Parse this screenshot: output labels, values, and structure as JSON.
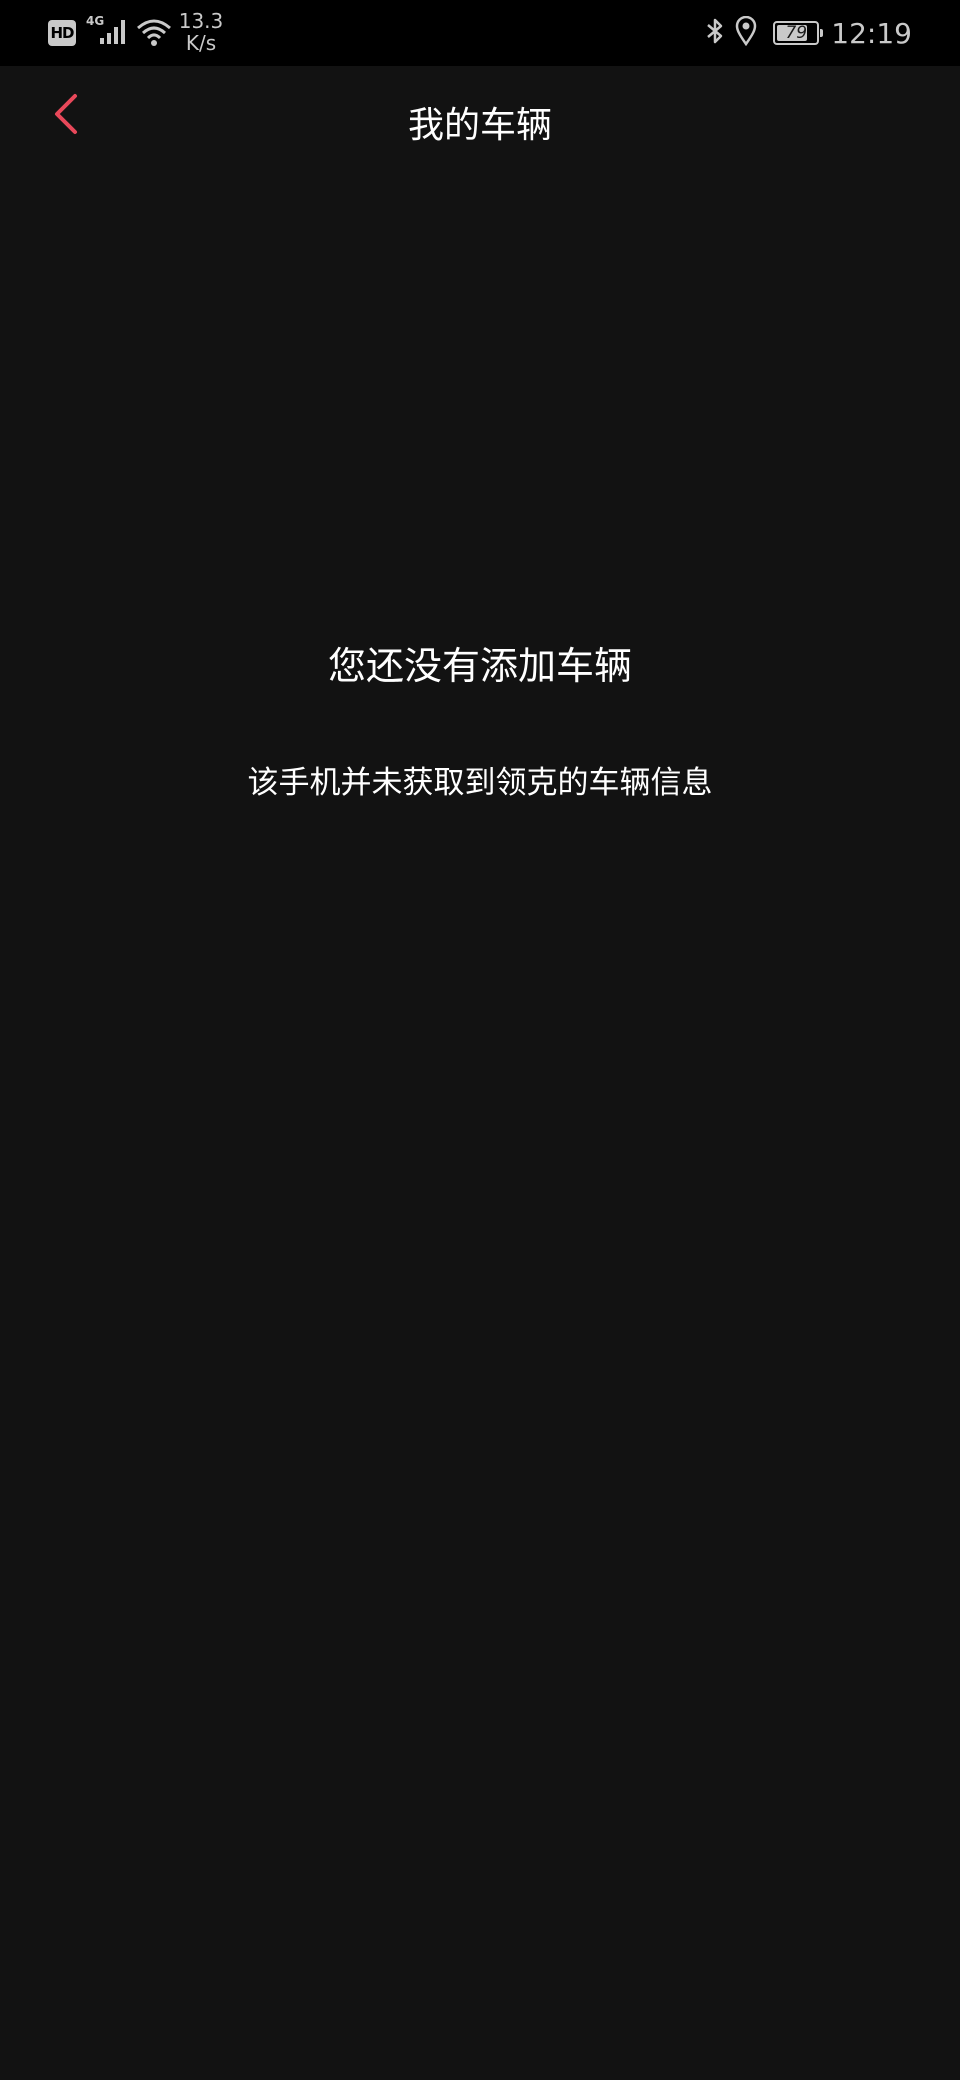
{
  "status_bar": {
    "hd_label": "HD",
    "network_type": "4G",
    "speed_value": "13.3",
    "speed_unit": "K/s",
    "battery_level": "79",
    "battery_fraction": 0.79,
    "time": "12:19",
    "icons": [
      "signal-icon",
      "wifi-icon",
      "bluetooth-icon",
      "location-icon",
      "battery-icon"
    ]
  },
  "header": {
    "title": "我的车辆",
    "back_icon": "chevron-left-icon",
    "accent_color": "#e8485a"
  },
  "empty_state": {
    "title": "您还没有添加车辆",
    "description": "该手机并未获取到领克的车辆信息"
  },
  "colors": {
    "background": "#121212",
    "status_bar_background": "#000000",
    "text_primary": "#ffffff",
    "status_text": "#c9c9c9"
  }
}
